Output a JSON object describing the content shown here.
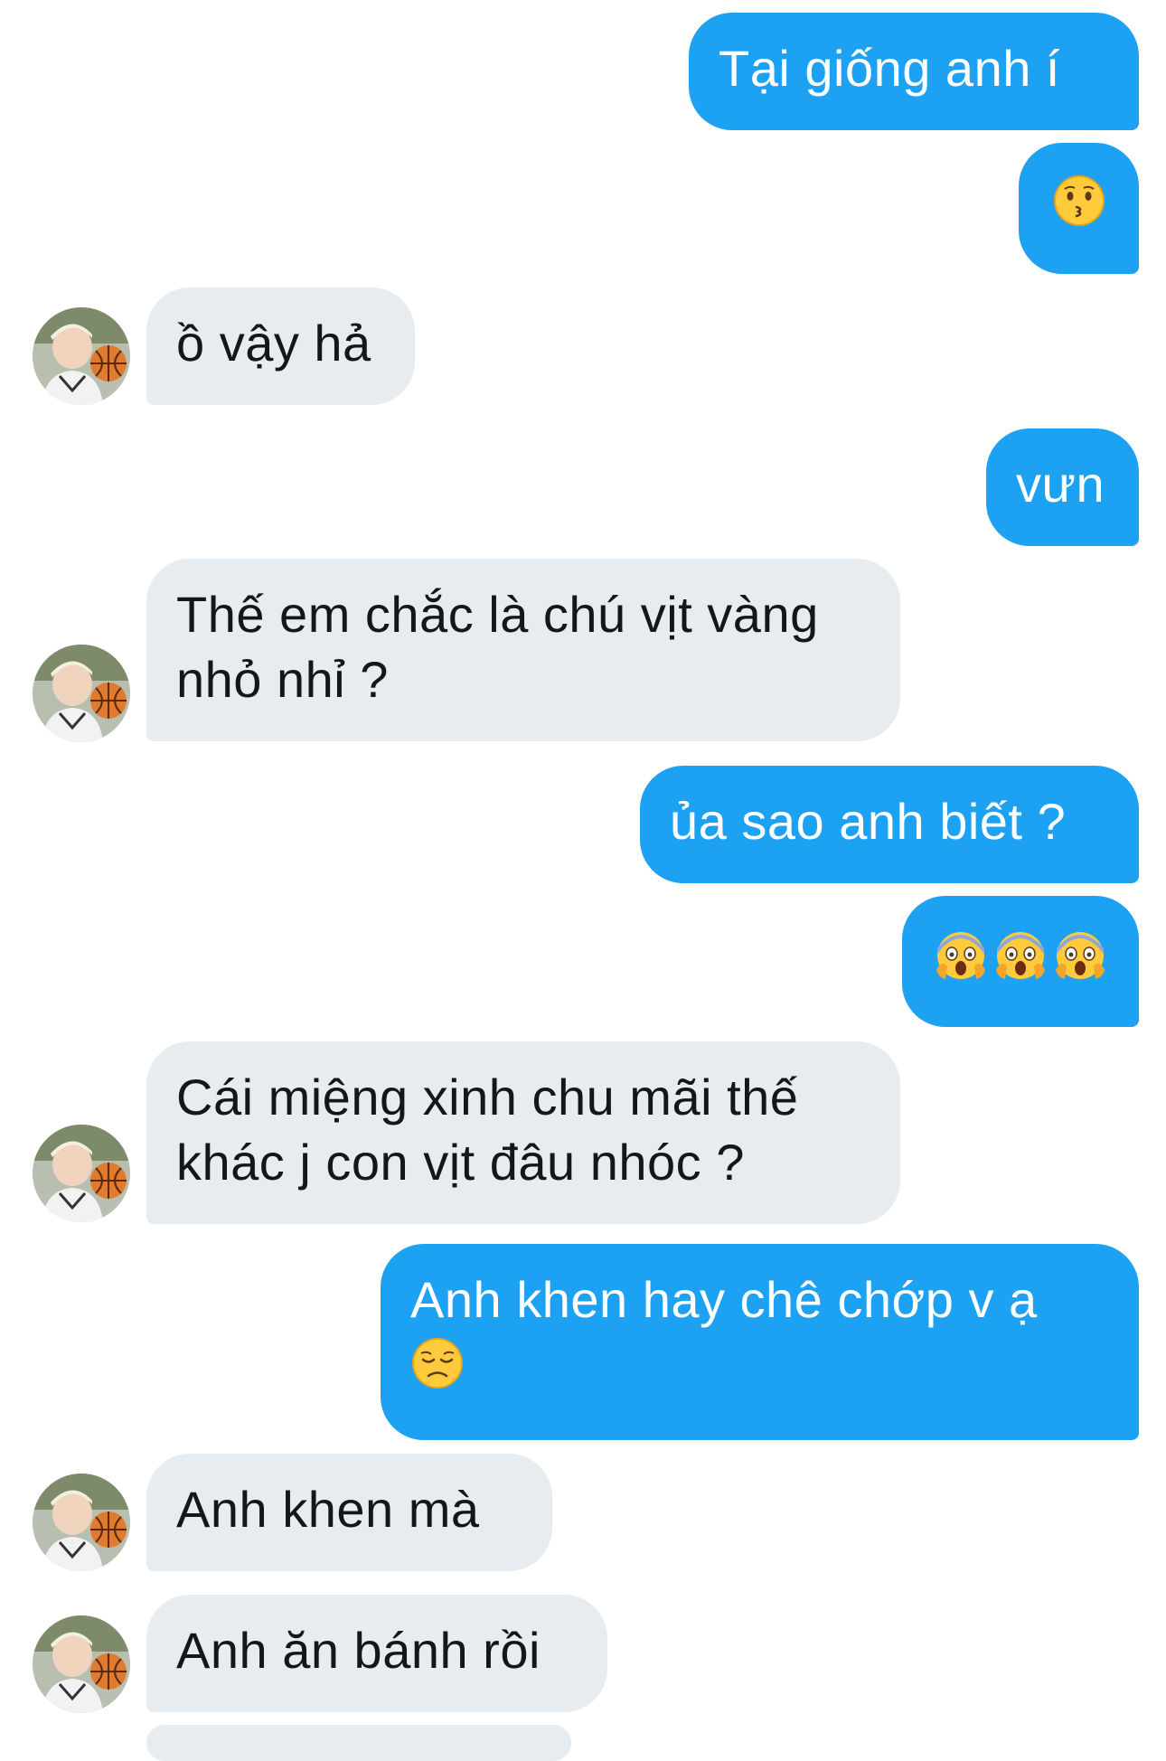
{
  "conversation": {
    "messages": [
      {
        "side": "out",
        "text": "Tại giống anh í"
      },
      {
        "side": "out",
        "emoji": [
          "kissing-face"
        ]
      },
      {
        "side": "in",
        "text": "ồ vậy hả"
      },
      {
        "side": "out",
        "text": "vưn"
      },
      {
        "side": "in",
        "text": "Thế em chắc là chú vịt vàng nhỏ nhỉ ?"
      },
      {
        "side": "out",
        "text": "ủa sao anh biết ?"
      },
      {
        "side": "out",
        "emoji": [
          "screaming-face",
          "screaming-face",
          "screaming-face"
        ]
      },
      {
        "side": "in",
        "text": "Cái miệng xinh chu mãi thế khác j con vịt đâu nhóc ?"
      },
      {
        "side": "out",
        "text": "Anh khen hay chê chớp v ạ",
        "emoji": [
          "disappointed-face"
        ]
      },
      {
        "side": "in",
        "text": "Anh khen mà"
      },
      {
        "side": "in",
        "text": "Anh ăn bánh rồi"
      }
    ]
  },
  "colors": {
    "outgoing_bubble": "#1da1f2",
    "incoming_bubble": "#e6ecf0",
    "outgoing_text": "#ffffff",
    "incoming_text": "#14171a"
  },
  "icons": {
    "avatar": "user-avatar-basketball",
    "kissing": "kissing-face-icon",
    "screaming": "face-screaming-in-fear-icon",
    "disappointed": "disappointed-face-icon"
  }
}
